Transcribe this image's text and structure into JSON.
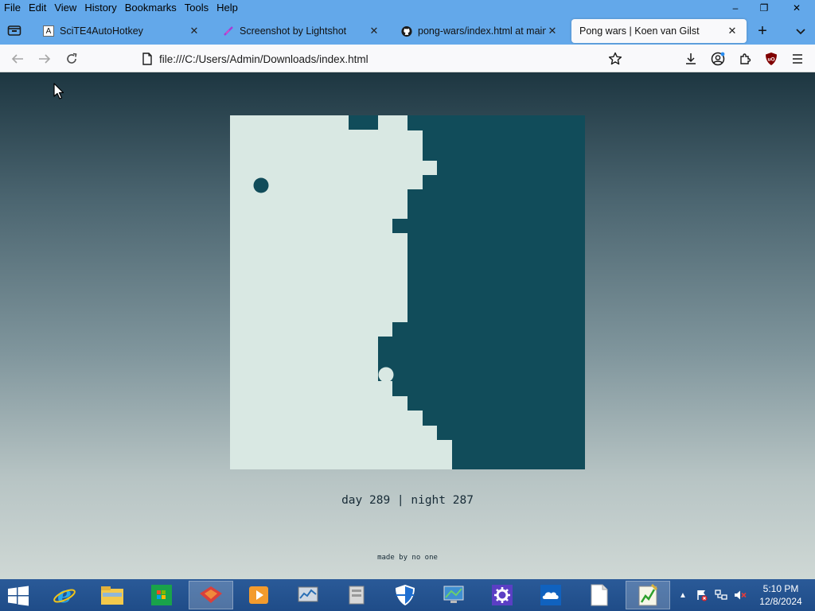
{
  "window": {
    "menu": [
      "File",
      "Edit",
      "View",
      "History",
      "Bookmarks",
      "Tools",
      "Help"
    ],
    "controls": {
      "minimize": "–",
      "restore": "❐",
      "close": "✕"
    }
  },
  "tabs": [
    {
      "title": "SciTE4AutoHotkey",
      "favicon": "A",
      "active": false
    },
    {
      "title": "Screenshot by Lightshot",
      "favicon": "feather-icon",
      "active": false
    },
    {
      "title": "pong-wars/index.html at main",
      "favicon": "github-icon",
      "active": false
    },
    {
      "title": "Pong wars | Koen van Gilst",
      "favicon": "",
      "active": true
    }
  ],
  "newtab_label": "+",
  "navbar": {
    "url": "file:///C:/Users/Admin/Downloads/index.html"
  },
  "page": {
    "score": "day 289 | night 287",
    "madeby": "made by no one",
    "colors": {
      "day": "#d9e8e3",
      "night": "#114c5a"
    }
  },
  "taskbar": {
    "apps": [
      "internet-explorer-icon",
      "file-explorer-icon",
      "store-icon",
      "app-icon",
      "media-player-icon",
      "resource-monitor-icon",
      "tool-icon",
      "defender-icon",
      "remote-desktop-icon",
      "settings-icon",
      "onedrive-icon",
      "notepad-icon",
      "scite-icon"
    ],
    "time": "5:10 PM",
    "date": "12/8/2024"
  }
}
